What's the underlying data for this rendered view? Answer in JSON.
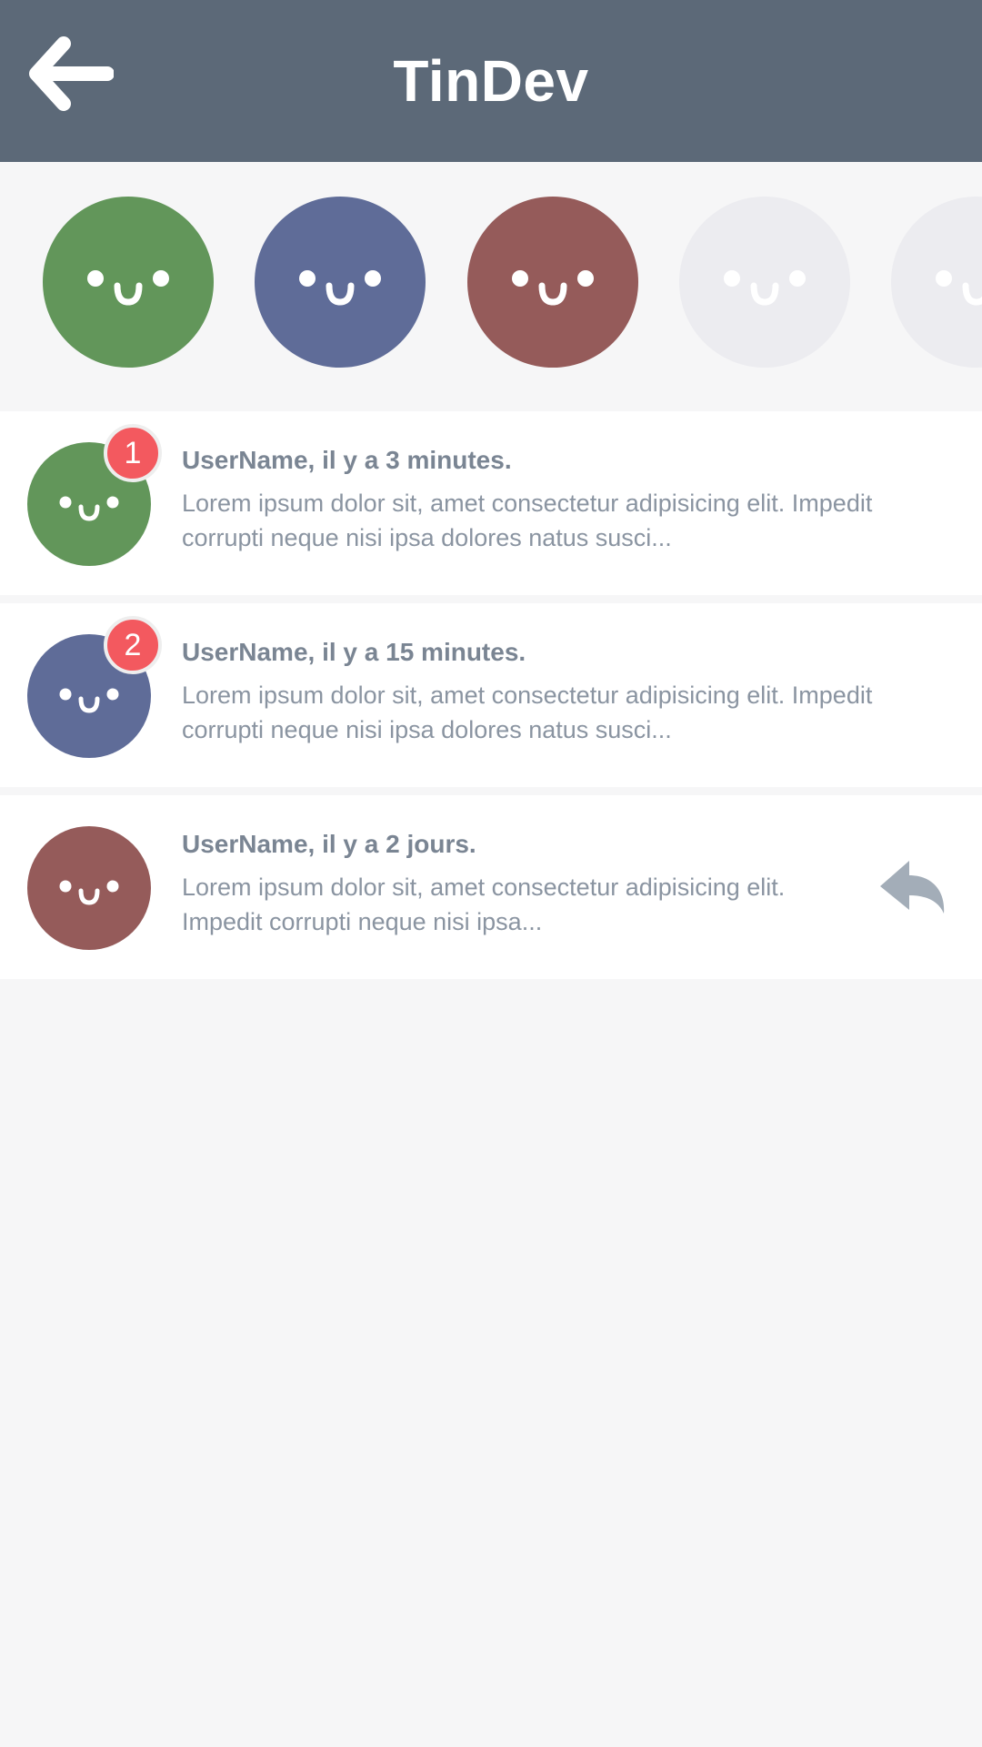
{
  "header": {
    "title": "TinDev",
    "back_icon": "arrow-left-icon"
  },
  "colors": {
    "header_bg": "#5c6978",
    "green": "#62965a",
    "blue": "#5f6c98",
    "red": "#955b5a",
    "placeholder": "#ececf0",
    "badge": "#f3595f",
    "text": "#7a8593"
  },
  "stories": [
    {
      "color": "green"
    },
    {
      "color": "blue"
    },
    {
      "color": "red"
    },
    {
      "color": "placeholder"
    },
    {
      "color": "placeholder"
    }
  ],
  "conversations": [
    {
      "title": "UserName, il y a 3 minutes.",
      "preview": "Lorem ipsum dolor sit, amet consectetur adipisicing elit. Impedit corrupti neque nisi ipsa dolores natus susci...",
      "badge": "1",
      "avatar_color": "green"
    },
    {
      "title": "UserName, il y a 15 minutes.",
      "preview": "Lorem ipsum dolor sit, amet consectetur adipisicing elit. Impedit corrupti neque nisi ipsa dolores natus susci...",
      "badge": "2",
      "avatar_color": "blue"
    },
    {
      "title": "UserName, il y a 2 jours.",
      "preview": "Lorem ipsum dolor sit, amet consectetur adipisicing elit. Impedit corrupti neque nisi ipsa...",
      "action_icon": "reply-icon",
      "avatar_color": "red"
    }
  ]
}
